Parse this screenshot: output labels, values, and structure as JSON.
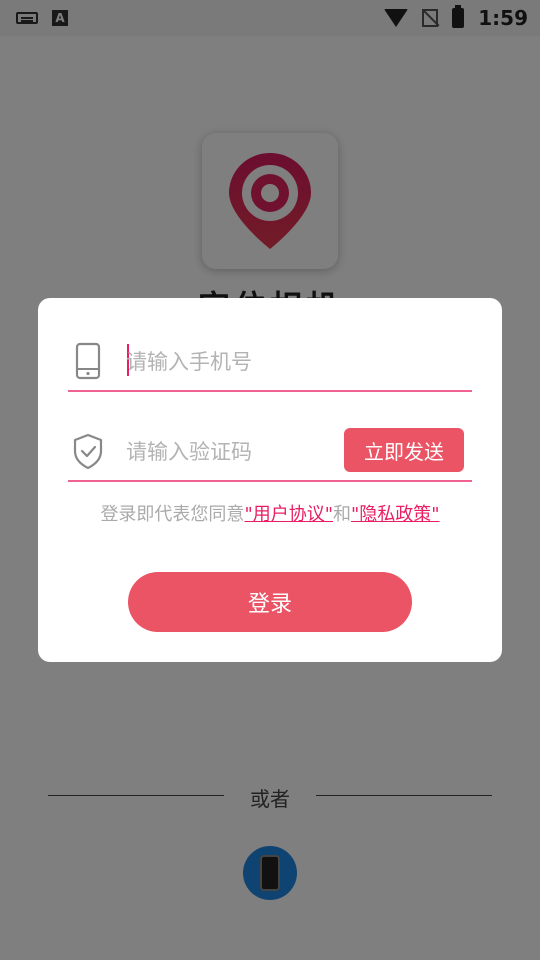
{
  "status_bar": {
    "time": "1:59",
    "left_icons": [
      "keyboard-icon",
      "a-icon"
    ],
    "right_icons": [
      "wifi-icon",
      "no-sim-icon",
      "battery-charging-icon"
    ]
  },
  "background": {
    "app_title": "定位相机",
    "or_text": "或者",
    "alt_login_icon": "phone-icon"
  },
  "dialog": {
    "phone_placeholder": "请输入手机号",
    "code_placeholder": "请输入验证码",
    "send_code_label": "立即发送",
    "agreement_prefix": "登录即代表您同意",
    "user_agreement": "\"用户协议\"",
    "and_text": "和",
    "privacy_policy": "\"隐私政策\"",
    "login_label": "登录"
  },
  "colors": {
    "accent": "#ea5465",
    "link": "#e91e63",
    "underline": "#f06292",
    "overlay": "rgba(0,0,0,0.5)"
  }
}
